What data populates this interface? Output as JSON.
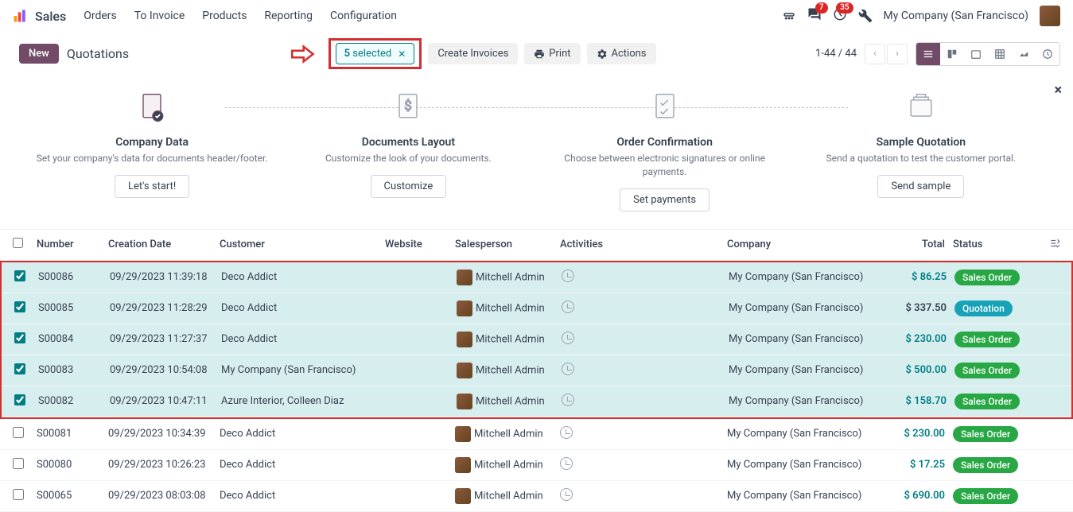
{
  "nav": {
    "app": "Sales",
    "menu": [
      "Orders",
      "To Invoice",
      "Products",
      "Reporting",
      "Configuration"
    ],
    "msg_count": "7",
    "activity_count": "35",
    "company": "My Company (San Francisco)"
  },
  "cp": {
    "new": "New",
    "title": "Quotations",
    "selected_count": "5",
    "selected_label": "selected",
    "create_invoices": "Create Invoices",
    "print": "Print",
    "actions": "Actions",
    "pager": "1-44 / 44"
  },
  "onboard": {
    "steps": [
      {
        "title": "Company Data",
        "desc": "Set your company's data for documents header/footer.",
        "btn": "Let's start!"
      },
      {
        "title": "Documents Layout",
        "desc": "Customize the look of your documents.",
        "btn": "Customize"
      },
      {
        "title": "Order Confirmation",
        "desc": "Choose between electronic signatures or online payments.",
        "btn": "Set payments"
      },
      {
        "title": "Sample Quotation",
        "desc": "Send a quotation to test the customer portal.",
        "btn": "Send sample"
      }
    ]
  },
  "table": {
    "headers": {
      "number": "Number",
      "date": "Creation Date",
      "customer": "Customer",
      "website": "Website",
      "salesperson": "Salesperson",
      "activities": "Activities",
      "company": "Company",
      "total": "Total",
      "status": "Status"
    },
    "rows": [
      {
        "sel": true,
        "num": "S00086",
        "date": "09/29/2023 11:39:18",
        "cust": "Deco Addict",
        "sales": "Mitchell Admin",
        "comp": "My Company (San Francisco)",
        "total": "$ 86.25",
        "total_color": "teal",
        "status": "Sales Order",
        "status_type": "sales"
      },
      {
        "sel": true,
        "num": "S00085",
        "date": "09/29/2023 11:28:29",
        "cust": "Deco Addict",
        "sales": "Mitchell Admin",
        "comp": "My Company (San Francisco)",
        "total": "$ 337.50",
        "total_color": "black",
        "status": "Quotation",
        "status_type": "quote"
      },
      {
        "sel": true,
        "num": "S00084",
        "date": "09/29/2023 11:27:37",
        "cust": "Deco Addict",
        "sales": "Mitchell Admin",
        "comp": "My Company (San Francisco)",
        "total": "$ 230.00",
        "total_color": "teal",
        "status": "Sales Order",
        "status_type": "sales"
      },
      {
        "sel": true,
        "num": "S00083",
        "date": "09/29/2023 10:54:08",
        "cust": "My Company (San Francisco)",
        "sales": "Mitchell Admin",
        "comp": "My Company (San Francisco)",
        "total": "$ 500.00",
        "total_color": "teal",
        "status": "Sales Order",
        "status_type": "sales"
      },
      {
        "sel": true,
        "num": "S00082",
        "date": "09/29/2023 10:47:11",
        "cust": "Azure Interior, Colleen Diaz",
        "sales": "Mitchell Admin",
        "comp": "My Company (San Francisco)",
        "total": "$ 158.70",
        "total_color": "teal",
        "status": "Sales Order",
        "status_type": "sales"
      },
      {
        "sel": false,
        "num": "S00081",
        "date": "09/29/2023 10:34:39",
        "cust": "Deco Addict",
        "sales": "Mitchell Admin",
        "comp": "My Company (San Francisco)",
        "total": "$ 230.00",
        "total_color": "teal",
        "status": "Sales Order",
        "status_type": "sales"
      },
      {
        "sel": false,
        "num": "S00080",
        "date": "09/29/2023 10:26:23",
        "cust": "Deco Addict",
        "sales": "Mitchell Admin",
        "comp": "My Company (San Francisco)",
        "total": "$ 17.25",
        "total_color": "teal",
        "status": "Sales Order",
        "status_type": "sales"
      },
      {
        "sel": false,
        "num": "S00065",
        "date": "09/29/2023 08:03:08",
        "cust": "Deco Addict",
        "sales": "Mitchell Admin",
        "comp": "My Company (San Francisco)",
        "total": "$ 690.00",
        "total_color": "teal",
        "status": "Sales Order",
        "status_type": "sales"
      }
    ]
  }
}
